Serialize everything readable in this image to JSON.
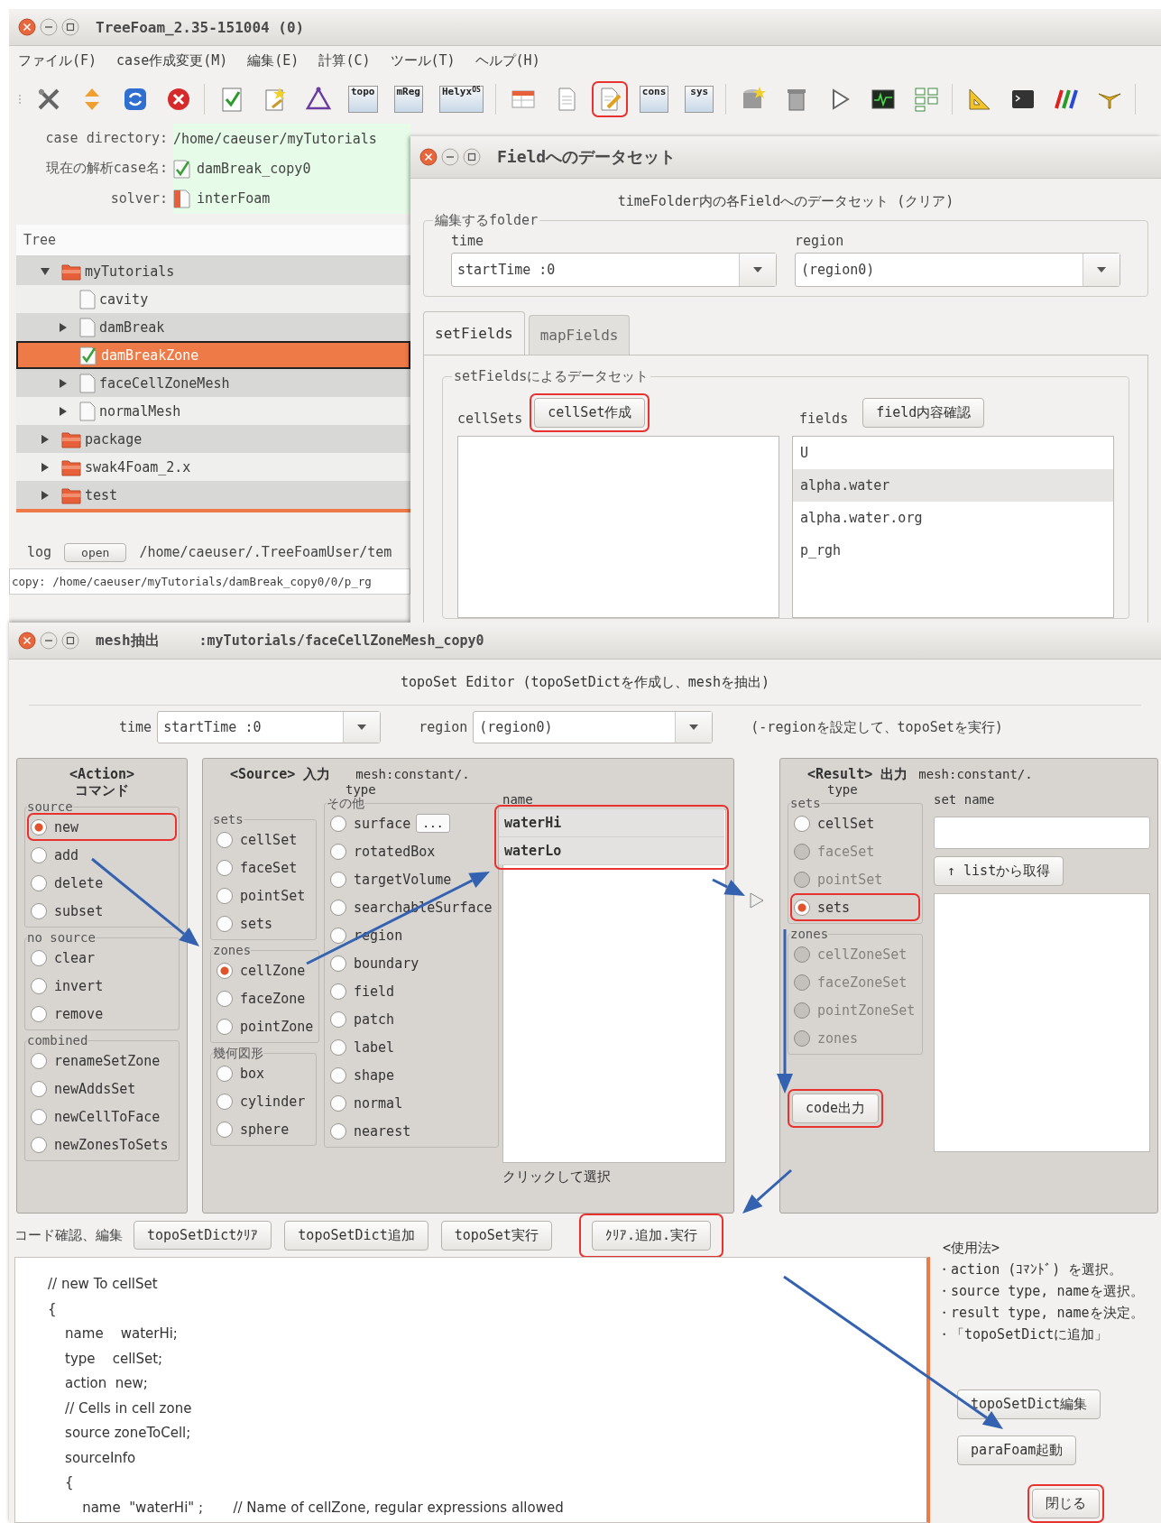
{
  "main_window": {
    "title": "TreeFoam_2.35-151004 (0)",
    "menu": [
      "ファイル(F)",
      "case作成変更(M)",
      "編集(E)",
      "計算(C)",
      "ツール(T)",
      "ヘルプ(H)"
    ],
    "toolbar": [
      [
        {
          "kind": "wrench",
          "highlighted": false
        },
        {
          "kind": "updown",
          "highlighted": false
        },
        {
          "kind": "refresh",
          "highlighted": false
        },
        {
          "kind": "stop",
          "highlighted": false
        }
      ],
      [
        {
          "kind": "checklist",
          "highlighted": false
        },
        {
          "kind": "note",
          "highlighted": false
        },
        {
          "kind": "triangle",
          "highlighted": false
        },
        {
          "kind": "label",
          "label": "topo",
          "highlighted": false
        },
        {
          "kind": "label",
          "label": "mReg",
          "highlighted": false
        },
        {
          "kind": "label",
          "label": "Helyx$^{OS}$",
          "highlighted": false
        }
      ],
      [
        {
          "kind": "table",
          "highlighted": false
        },
        {
          "kind": "document",
          "highlighted": false
        },
        {
          "kind": "pencil",
          "highlighted": true
        },
        {
          "kind": "label",
          "label": "cons",
          "highlighted": false
        },
        {
          "kind": "label",
          "label": "sys",
          "highlighted": false
        }
      ],
      [
        {
          "kind": "database",
          "highlighted": false
        },
        {
          "kind": "bin",
          "highlighted": false
        },
        {
          "kind": "play",
          "highlighted": false
        },
        {
          "kind": "monitor",
          "highlighted": false
        },
        {
          "kind": "grid",
          "highlighted": false
        }
      ],
      [
        {
          "kind": "ruler",
          "highlighted": false
        },
        {
          "kind": "terminal",
          "highlighted": false
        },
        {
          "kind": "stripes",
          "highlighted": false
        },
        {
          "kind": "antenna",
          "highlighted": false
        }
      ]
    ]
  },
  "case_info": [
    {
      "kind": "plain",
      "label": "case directory:",
      "value": "/home/caeuser/myTutorials"
    },
    {
      "kind": "case",
      "label": "現在の解析case名:",
      "value": "damBreak_copy0"
    },
    {
      "kind": "solver",
      "label": "solver:",
      "value": "interFoam"
    }
  ],
  "tree": {
    "header": "Tree",
    "items": [
      {
        "kind": "folder",
        "label": "myTutorials",
        "selected": false,
        "expanded": true,
        "children": [
          {
            "kind": "file",
            "label": "cavity",
            "selected": false
          },
          {
            "kind": "file",
            "label": "damBreak",
            "selected": false,
            "expanded": false
          },
          {
            "kind": "case",
            "label": "damBreakZone",
            "selected": true
          },
          {
            "kind": "file",
            "label": "faceCellZoneMesh",
            "selected": false,
            "expanded": false
          },
          {
            "kind": "file",
            "label": "normalMesh",
            "selected": false,
            "expanded": false
          }
        ]
      },
      {
        "kind": "folder",
        "label": "package",
        "selected": false,
        "expanded": false
      },
      {
        "kind": "folder",
        "label": "swak4Foam_2.x",
        "selected": false,
        "expanded": false
      },
      {
        "kind": "folder",
        "label": "test",
        "selected": false,
        "expanded": false
      }
    ]
  },
  "log": {
    "label": "log",
    "button": "open",
    "path": "/home/caeuser/.TreeFoamUser/tem",
    "lines": [
      "copy: /home/caeuser/myTutorials/damBreak_copy0/0/p_rg"
    ]
  },
  "field_dialog": {
    "title": "Fieldへのデータセット",
    "heading": "timeFolder内の各Fieldへのデータセット (クリア)",
    "folder_group": {
      "legend": "編集するfolder",
      "time": {
        "label": "time",
        "value": "startTime :0"
      },
      "region": {
        "label": "region",
        "value": "(region0)"
      }
    },
    "tabs": [
      {
        "label": "setFields",
        "selected": true
      },
      {
        "label": "mapFields",
        "selected": false
      }
    ],
    "setfields": {
      "legend": "setFieldsによるデータセット",
      "cellsets_label": "cellSets",
      "create_button": {
        "label": "cellSet作成",
        "highlighted": true
      },
      "fields_label": "fields",
      "check_button": "field内容確認",
      "fields": [
        {
          "label": "U",
          "selected": false
        },
        {
          "label": "alpha.water",
          "selected": true
        },
        {
          "label": "alpha.water.org",
          "selected": false
        },
        {
          "label": "p_rgh",
          "selected": false
        }
      ]
    }
  },
  "mesh_dialog": {
    "title": "mesh抽出",
    "subtitle": ":myTutorials/faceCellZoneMesh_copy0",
    "heading": "topoSet Editor (topoSetDictを作成し、meshを抽出)",
    "time": {
      "label": "time",
      "value": "startTime :0"
    },
    "region": {
      "label": "region",
      "value": "(region0)"
    },
    "region_note": "(-regionを設定して、topoSetを実行)",
    "action_panel": {
      "title": "<Action>",
      "subtitle": "コマンド",
      "groups": [
        {
          "legend": "source",
          "options": [
            {
              "label": "new",
              "selected": true,
              "disabled": false,
              "highlighted": true
            },
            {
              "label": "add",
              "selected": false,
              "disabled": false,
              "highlighted": false
            },
            {
              "label": "delete",
              "selected": false,
              "disabled": false,
              "highlighted": false
            },
            {
              "label": "subset",
              "selected": false,
              "disabled": false,
              "highlighted": false
            }
          ]
        },
        {
          "legend": "no source",
          "options": [
            {
              "label": "clear",
              "selected": false,
              "disabled": false,
              "highlighted": false
            },
            {
              "label": "invert",
              "selected": false,
              "disabled": false,
              "highlighted": false
            },
            {
              "label": "remove",
              "selected": false,
              "disabled": false,
              "highlighted": false
            }
          ]
        },
        {
          "legend": "combined",
          "options": [
            {
              "label": "renameSetZone",
              "selected": false,
              "disabled": false,
              "highlighted": false
            },
            {
              "label": "newAddsSet",
              "selected": false,
              "disabled": false,
              "highlighted": false
            },
            {
              "label": "newCellToFace",
              "selected": false,
              "disabled": false,
              "highlighted": false
            },
            {
              "label": "newZonesToSets",
              "selected": false,
              "disabled": false,
              "highlighted": false
            }
          ]
        }
      ]
    },
    "source_panel": {
      "title": "<Source> 入力",
      "location": "mesh:constant/.",
      "type_label": "type",
      "groups": [
        {
          "legend": "sets",
          "options": [
            {
              "label": "cellSet",
              "selected": false,
              "disabled": false,
              "highlighted": false
            },
            {
              "label": "faceSet",
              "selected": false,
              "disabled": false,
              "highlighted": false
            },
            {
              "label": "pointSet",
              "selected": false,
              "disabled": false,
              "highlighted": false
            },
            {
              "label": "sets",
              "selected": false,
              "disabled": false,
              "highlighted": false
            }
          ]
        },
        {
          "legend": "zones",
          "options": [
            {
              "label": "cellZone",
              "selected": true,
              "disabled": false,
              "highlighted": false
            },
            {
              "label": "faceZone",
              "selected": false,
              "disabled": false,
              "highlighted": false
            },
            {
              "label": "pointZone",
              "selected": false,
              "disabled": false,
              "highlighted": false
            }
          ]
        },
        {
          "legend": "幾何図形",
          "options": [
            {
              "label": "box",
              "selected": false,
              "disabled": false,
              "highlighted": false
            },
            {
              "label": "cylinder",
              "selected": false,
              "disabled": false,
              "highlighted": false
            },
            {
              "label": "sphere",
              "selected": false,
              "disabled": false,
              "highlighted": false
            }
          ]
        }
      ],
      "other_group": {
        "legend": "その他",
        "options": [
          {
            "label": "surface",
            "selected": false,
            "disabled": false,
            "highlighted": false,
            "button": "..."
          },
          {
            "label": "rotatedBox",
            "selected": false,
            "disabled": false,
            "highlighted": false
          },
          {
            "label": "targetVolume",
            "selected": false,
            "disabled": false,
            "highlighted": false
          },
          {
            "label": "searchableSurface",
            "selected": false,
            "disabled": false,
            "highlighted": false
          },
          {
            "label": "region",
            "selected": false,
            "disabled": false,
            "highlighted": false
          },
          {
            "label": "boundary",
            "selected": false,
            "disabled": false,
            "highlighted": false
          },
          {
            "label": "field",
            "selected": false,
            "disabled": false,
            "highlighted": false
          },
          {
            "label": "patch",
            "selected": false,
            "disabled": false,
            "highlighted": false
          },
          {
            "label": "label",
            "selected": false,
            "disabled": false,
            "highlighted": false
          },
          {
            "label": "shape",
            "selected": false,
            "disabled": false,
            "highlighted": false
          },
          {
            "label": "normal",
            "selected": false,
            "disabled": false,
            "highlighted": false
          },
          {
            "label": "nearest",
            "selected": false,
            "disabled": false,
            "highlighted": false
          }
        ]
      },
      "name_label": "name",
      "names_highlighted": true,
      "names": [
        {
          "label": "waterHi",
          "selected": true
        },
        {
          "label": "waterLo",
          "selected": true
        }
      ],
      "hint": "クリックして選択"
    },
    "result_panel": {
      "title": "<Result> 出力",
      "location": "mesh:constant/.",
      "type_label": "type",
      "groups": [
        {
          "legend": "sets",
          "options": [
            {
              "label": "cellSet",
              "selected": false,
              "disabled": false,
              "highlighted": false
            },
            {
              "label": "faceSet",
              "selected": false,
              "disabled": true,
              "highlighted": false
            },
            {
              "label": "pointSet",
              "selected": false,
              "disabled": true,
              "highlighted": false
            },
            {
              "label": "sets",
              "selected": true,
              "disabled": false,
              "highlighted": true
            }
          ]
        },
        {
          "legend": "zones",
          "options": [
            {
              "label": "cellZoneSet",
              "selected": false,
              "disabled": true,
              "highlighted": false
            },
            {
              "label": "faceZoneSet",
              "selected": false,
              "disabled": true,
              "highlighted": false
            },
            {
              "label": "pointZoneSet",
              "selected": false,
              "disabled": true,
              "highlighted": false
            },
            {
              "label": "zones",
              "selected": false,
              "disabled": true,
              "highlighted": false
            }
          ]
        }
      ],
      "set_name_label": "set name",
      "get_button": "↑ listから取得",
      "code_button": {
        "label": "code出力",
        "highlighted": true
      }
    },
    "code_bar": {
      "label": "コード確認、編集",
      "buttons": [
        {
          "label": "topoSetDictｸﾘｱ",
          "highlighted": false
        },
        {
          "label": "topoSetDict追加",
          "highlighted": false
        },
        {
          "label": "topoSet実行",
          "highlighted": false
        },
        {
          "label": "ｸﾘｱ.追加.実行",
          "highlighted": true
        }
      ]
    },
    "code": [
      "// new To cellSet",
      "{",
      "    name    waterHi;",
      "    type    cellSet;",
      "    action  new;",
      "    // Cells in cell zone",
      "    source zoneToCell;",
      "    sourceInfo",
      "    {",
      "        name  \"waterHi\" ;       // Name of cellZone, regular expressions allowed"
    ],
    "usage": {
      "title": "<使用法>",
      "lines": [
        "・action (ｺﾏﾝﾄﾞ) を選択。",
        "・source type, nameを選択。",
        "・result type, nameを決定。",
        "・「topoSetDictに追加」"
      ],
      "buttons": [
        {
          "label": "topoSetDict編集",
          "highlighted": false
        },
        {
          "label": "paraFoam起動",
          "highlighted": false
        },
        {
          "label": "閉じる",
          "highlighted": true
        }
      ]
    }
  }
}
